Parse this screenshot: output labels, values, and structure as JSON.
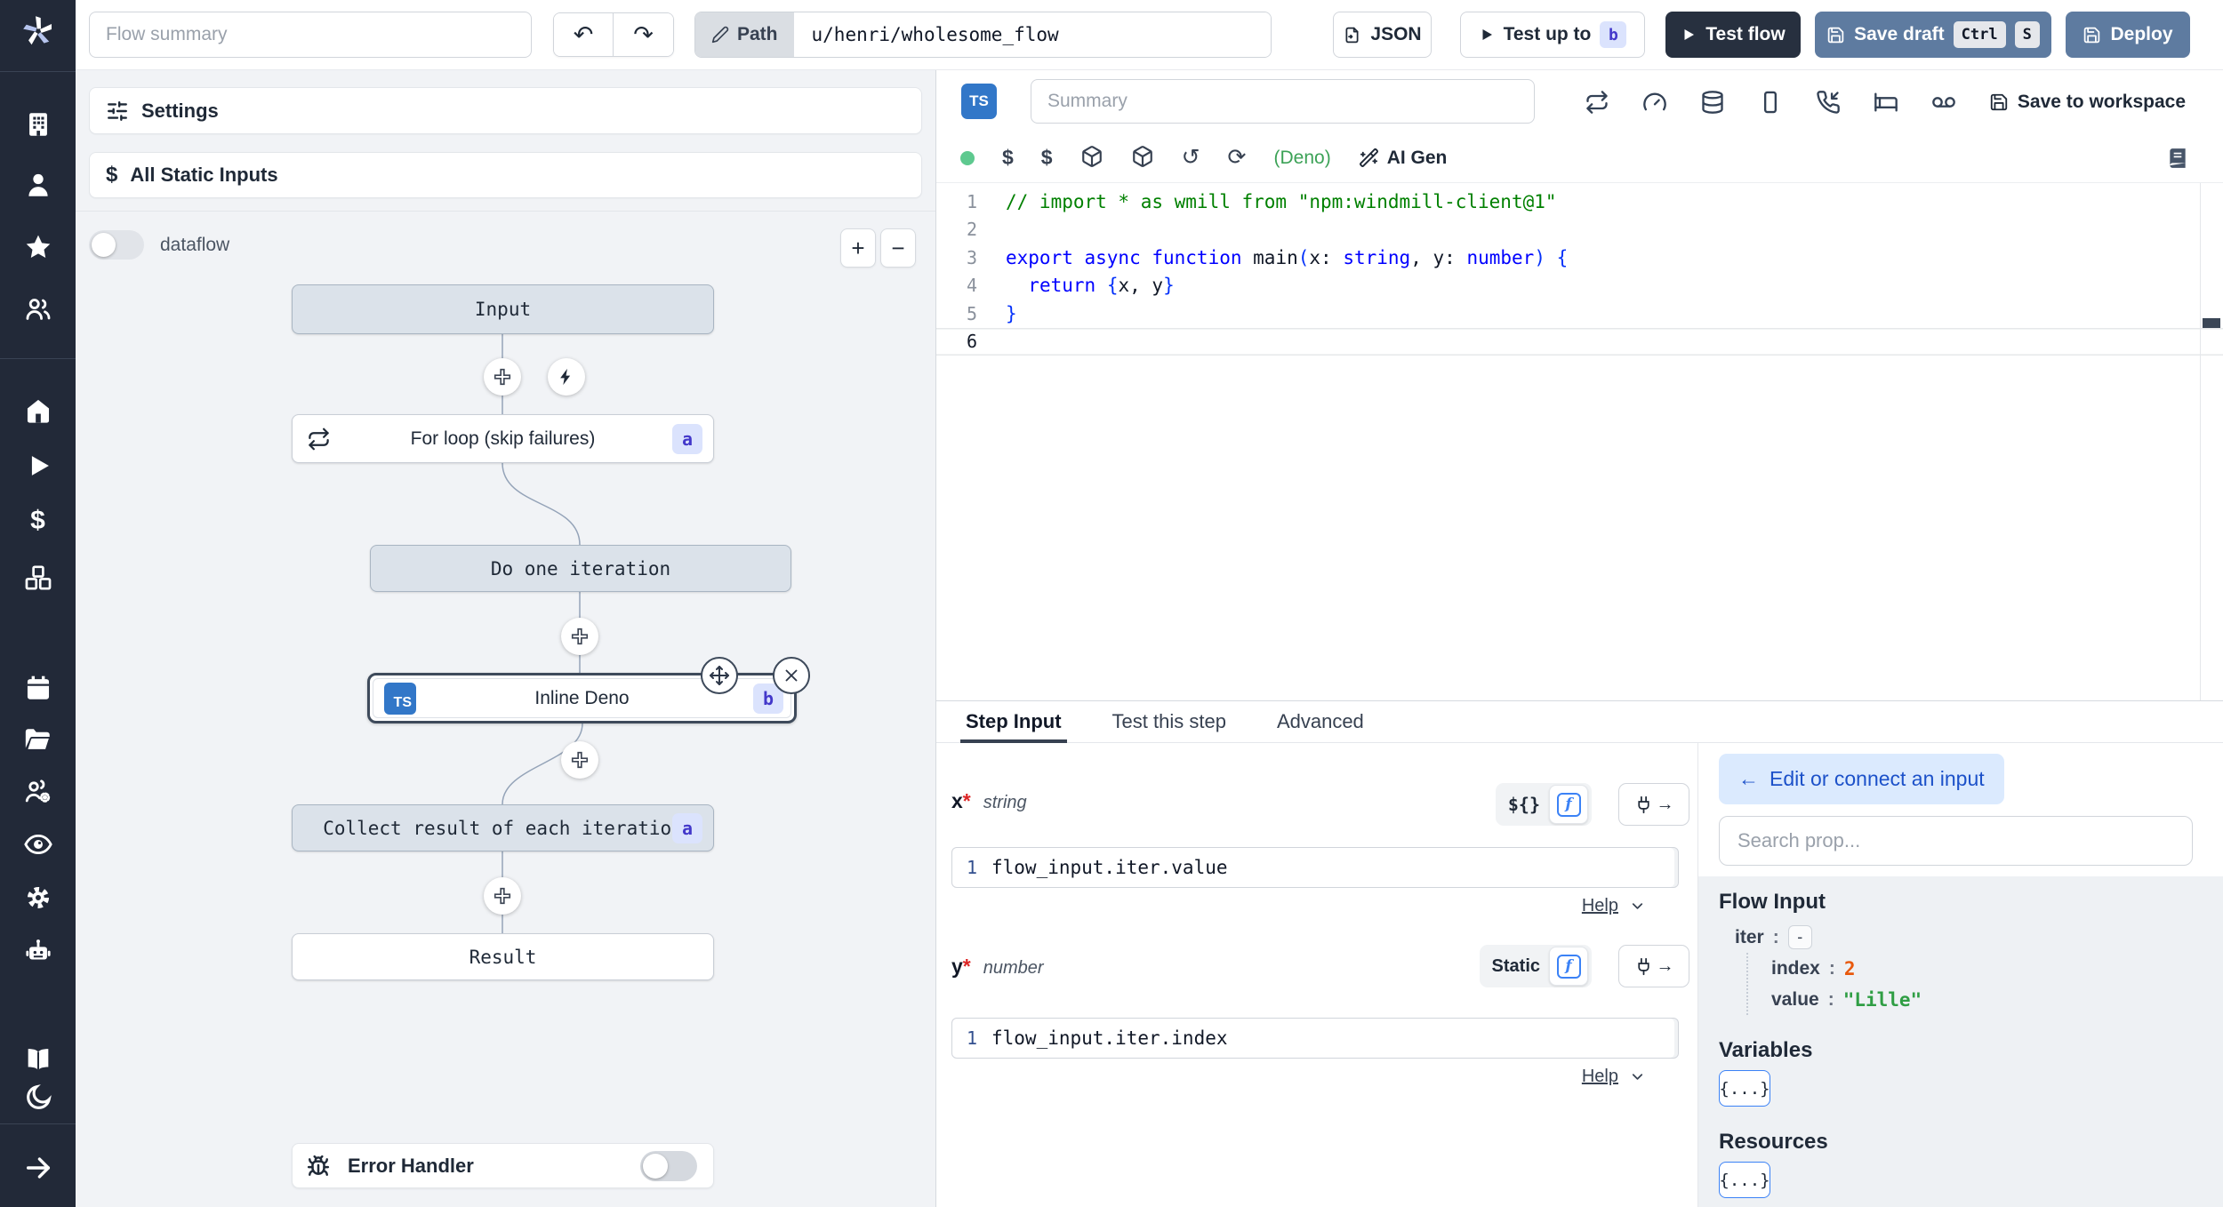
{
  "topbar": {
    "flow_summary_placeholder": "Flow summary",
    "path_label": "Path",
    "path_value": "u/henri/wholesome_flow",
    "json_button": "JSON",
    "test_up_to_label": "Test up to",
    "test_up_to_badge": "b",
    "test_flow_label": "Test flow",
    "save_draft_label": "Save draft",
    "kbd_ctrl": "Ctrl",
    "kbd_s": "S",
    "deploy_label": "Deploy"
  },
  "flow_panel": {
    "settings_label": "Settings",
    "static_inputs_label": "All Static Inputs",
    "dataflow_label": "dataflow",
    "zoom_in": "+",
    "zoom_out": "−",
    "error_handler_label": "Error Handler"
  },
  "graph": {
    "nodes": [
      {
        "label": "Input"
      },
      {
        "label": "For loop (skip failures)",
        "badge": "a"
      },
      {
        "label": "Do one iteration"
      },
      {
        "label": "Inline Deno",
        "badge": "b",
        "lang": "TS"
      },
      {
        "label": "Collect result of each iteration",
        "badge": "a"
      },
      {
        "label": "Result"
      }
    ]
  },
  "editor": {
    "lang_badge": "TS",
    "summary_placeholder": "Summary",
    "save_to_workspace": "Save to workspace",
    "runtime_label": "(Deno)",
    "ai_gen_label": "AI Gen",
    "active_line": 6,
    "code_lines": [
      [
        [
          "c",
          "// import * as wmill from \"npm:windmill-client@1\""
        ]
      ],
      [],
      [
        [
          "k",
          "export async function "
        ],
        [
          "i",
          "main"
        ],
        [
          "b",
          "("
        ],
        [
          "i",
          "x"
        ],
        [
          "p",
          ": "
        ],
        [
          "t",
          "string"
        ],
        [
          "p",
          ", "
        ],
        [
          "i",
          "y"
        ],
        [
          "p",
          ": "
        ],
        [
          "t",
          "number"
        ],
        [
          "b",
          ") {"
        ]
      ],
      [
        [
          "p",
          "  "
        ],
        [
          "k",
          "return"
        ],
        [
          "p",
          " "
        ],
        [
          "b",
          "{"
        ],
        [
          "i",
          "x"
        ],
        [
          "p",
          ", "
        ],
        [
          "i",
          "y"
        ],
        [
          "b",
          "}"
        ]
      ],
      [
        [
          "b",
          "}"
        ]
      ],
      []
    ]
  },
  "step_panel": {
    "tabs": [
      "Step Input",
      "Test this step",
      "Advanced"
    ],
    "fields": [
      {
        "name": "x",
        "required": "*",
        "type": "string",
        "mode": "${}",
        "line_no": "1",
        "expr": "flow_input.iter.value",
        "help": "Help"
      },
      {
        "name": "y",
        "required": "*",
        "type": "number",
        "mode": "Static",
        "line_no": "1",
        "expr": "flow_input.iter.index",
        "help": "Help"
      }
    ]
  },
  "prop_panel": {
    "back_arrow": "←",
    "back_label": "Edit or connect an input",
    "search_placeholder": "Search prop...",
    "flow_input_title": "Flow Input",
    "tree": {
      "sep": ":",
      "iter_key": "iter",
      "iter_collapse": "-",
      "index_key": "index",
      "index_value": "2",
      "value_key": "value",
      "value_value": "\"Lille\""
    },
    "variables_title": "Variables",
    "variables_value": "{...}",
    "resources_title": "Resources",
    "resources_value": "{...}"
  },
  "colors": {
    "sidebar": "#222938",
    "steel_blue": "#5e7ba0",
    "dark_button": "#27303f",
    "accent": "#3b82f6",
    "badge_bg": "#dbe3fd",
    "badge_text": "#4338ca",
    "number_orange": "#e8590c",
    "string_green": "#2f9e44",
    "comment_green": "#008000",
    "keyword_blue": "#0000ff"
  }
}
